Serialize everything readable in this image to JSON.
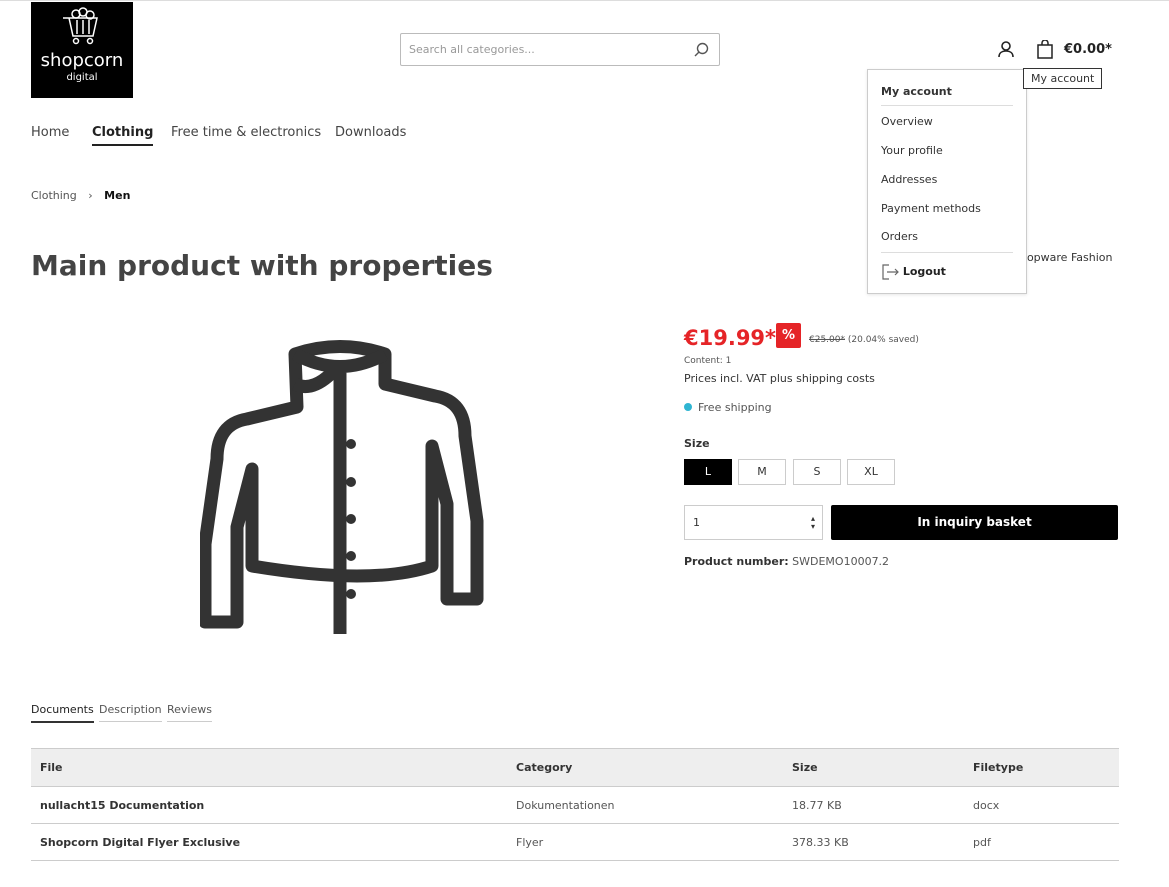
{
  "header": {
    "logo_text": "shopcorn",
    "logo_sub": "digital",
    "search_placeholder": "Search all categories...",
    "cart_total": "€0.00*",
    "tooltip": "My account"
  },
  "nav": [
    "Home",
    "Clothing",
    "Free time & electronics",
    "Downloads"
  ],
  "account_menu": {
    "title": "My account",
    "items": [
      "Overview",
      "Your profile",
      "Addresses",
      "Payment methods",
      "Orders"
    ],
    "logout": "Logout"
  },
  "breadcrumb": [
    "Clothing",
    "Men"
  ],
  "product": {
    "title": "Main product with properties",
    "manufacturer": "Shopware Fashion",
    "price": "€19.99*",
    "badge": "%",
    "old_price": "€25.00*",
    "saved": "(20.04% saved)",
    "content": "Content: 1",
    "tax_note": "Prices incl. VAT plus shipping costs",
    "shipping": "Free shipping",
    "size_label": "Size",
    "sizes": [
      "L",
      "M",
      "S",
      "XL"
    ],
    "selected_size": "L",
    "quantity": "1",
    "buy_label": "In inquiry basket",
    "number_label": "Product number:",
    "number": "SWDEMO10007.2",
    "accent": "#e52427",
    "shipping_dot": "#2fb5d2"
  },
  "tabs": [
    "Documents",
    "Description",
    "Reviews"
  ],
  "documents": {
    "headers": [
      "File",
      "Category",
      "Size",
      "Filetype"
    ],
    "rows": [
      [
        "nullacht15 Documentation",
        "Dokumentationen",
        "18.77 KB",
        "docx"
      ],
      [
        "Shopcorn Digital Flyer Exclusive",
        "Flyer",
        "378.33 KB",
        "pdf"
      ]
    ]
  }
}
